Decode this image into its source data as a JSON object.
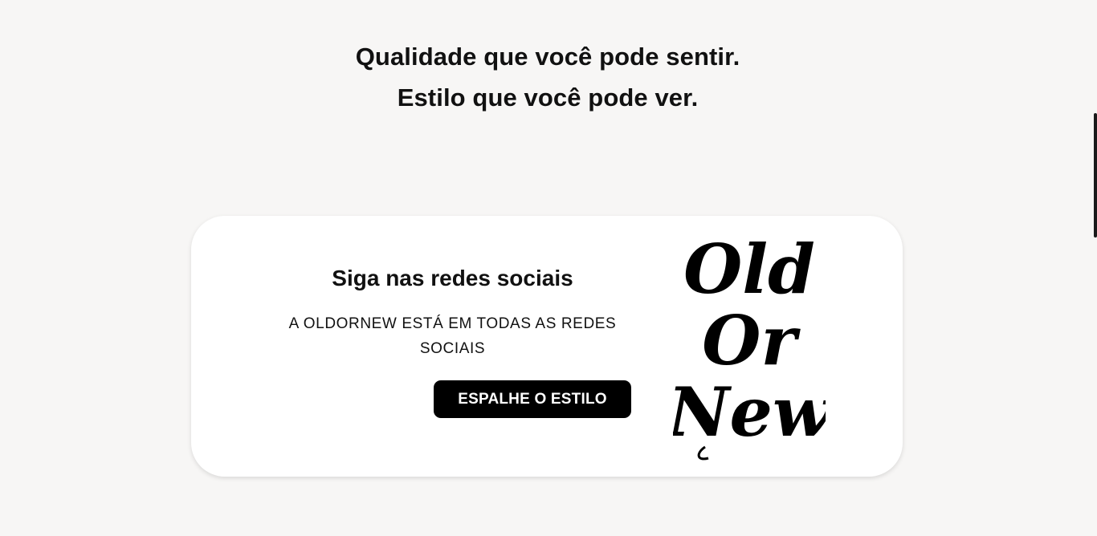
{
  "hero": {
    "headline": "Qualidade que você pode sentir. Estilo que você pode ver."
  },
  "social_card": {
    "title": "Siga nas redes sociais",
    "subtitle": "A OLDORNEW ESTÁ EM TODAS AS REDES SOCIAIS",
    "cta_label": "ESPALHE O ESTILO",
    "logo": {
      "icon": "oldornew-blackletter-logo",
      "lines": [
        "Old",
        "Or",
        "New"
      ]
    }
  },
  "colors": {
    "page_background": "#f7f6f5",
    "card_background": "#ffffff",
    "button_background": "#000000",
    "button_text": "#ffffff",
    "text": "#111111"
  }
}
